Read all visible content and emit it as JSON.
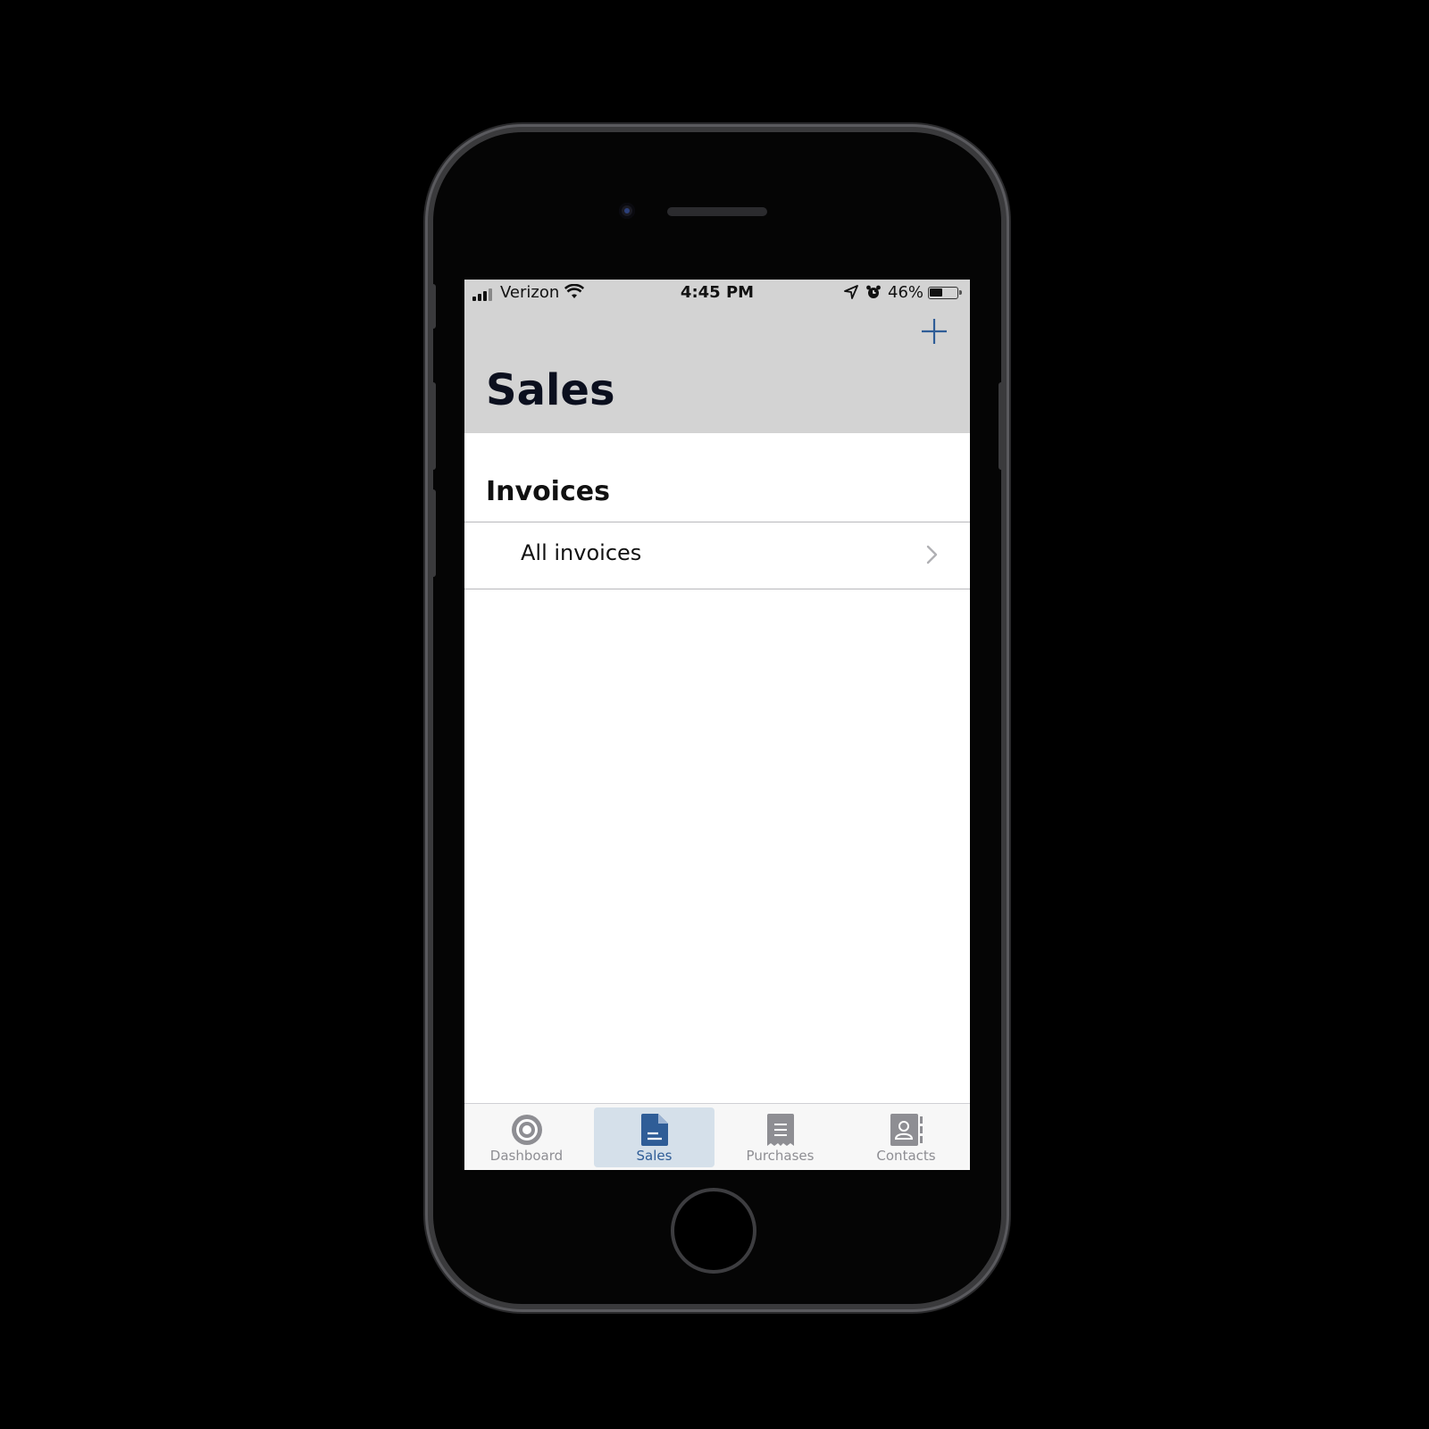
{
  "status_bar": {
    "carrier": "Verizon",
    "time": "4:45 PM",
    "battery_percent": "46%",
    "battery_level": 0.46
  },
  "header": {
    "title": "Sales",
    "add_icon": "plus-icon"
  },
  "section": {
    "title": "Invoices",
    "items": [
      {
        "label": "All invoices",
        "icon": "chevron-right-icon"
      }
    ]
  },
  "tab_bar": {
    "tabs": [
      {
        "label": "Dashboard",
        "icon": "target-icon",
        "active": false
      },
      {
        "label": "Sales",
        "icon": "document-icon",
        "active": true
      },
      {
        "label": "Purchases",
        "icon": "receipt-icon",
        "active": false
      },
      {
        "label": "Contacts",
        "icon": "contact-book-icon",
        "active": false
      }
    ]
  },
  "colors": {
    "accent": "#2f5d97",
    "header_bg": "#d3d3d3",
    "inactive_tab": "#8e8e93"
  }
}
